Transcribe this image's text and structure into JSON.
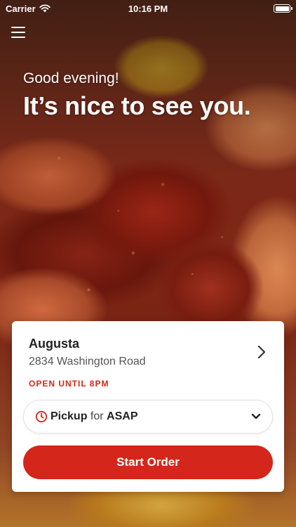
{
  "status_bar": {
    "carrier": "Carrier",
    "time": "10:16 PM"
  },
  "greeting": {
    "salutation": "Good evening!",
    "headline": "It’s nice to see you."
  },
  "store": {
    "name": "Augusta",
    "address": "2834 Washington Road",
    "hours": "OPEN UNTIL 8PM"
  },
  "order_mode": {
    "method": "Pickup",
    "connector": "for",
    "time": "ASAP"
  },
  "actions": {
    "start_order": "Start Order"
  },
  "colors": {
    "accent": "#d4261a",
    "card_background": "#ffffff"
  },
  "icons": [
    "wifi-icon",
    "battery-icon",
    "menu-icon",
    "chevron-right-icon",
    "clock-icon",
    "chevron-down-icon"
  ]
}
